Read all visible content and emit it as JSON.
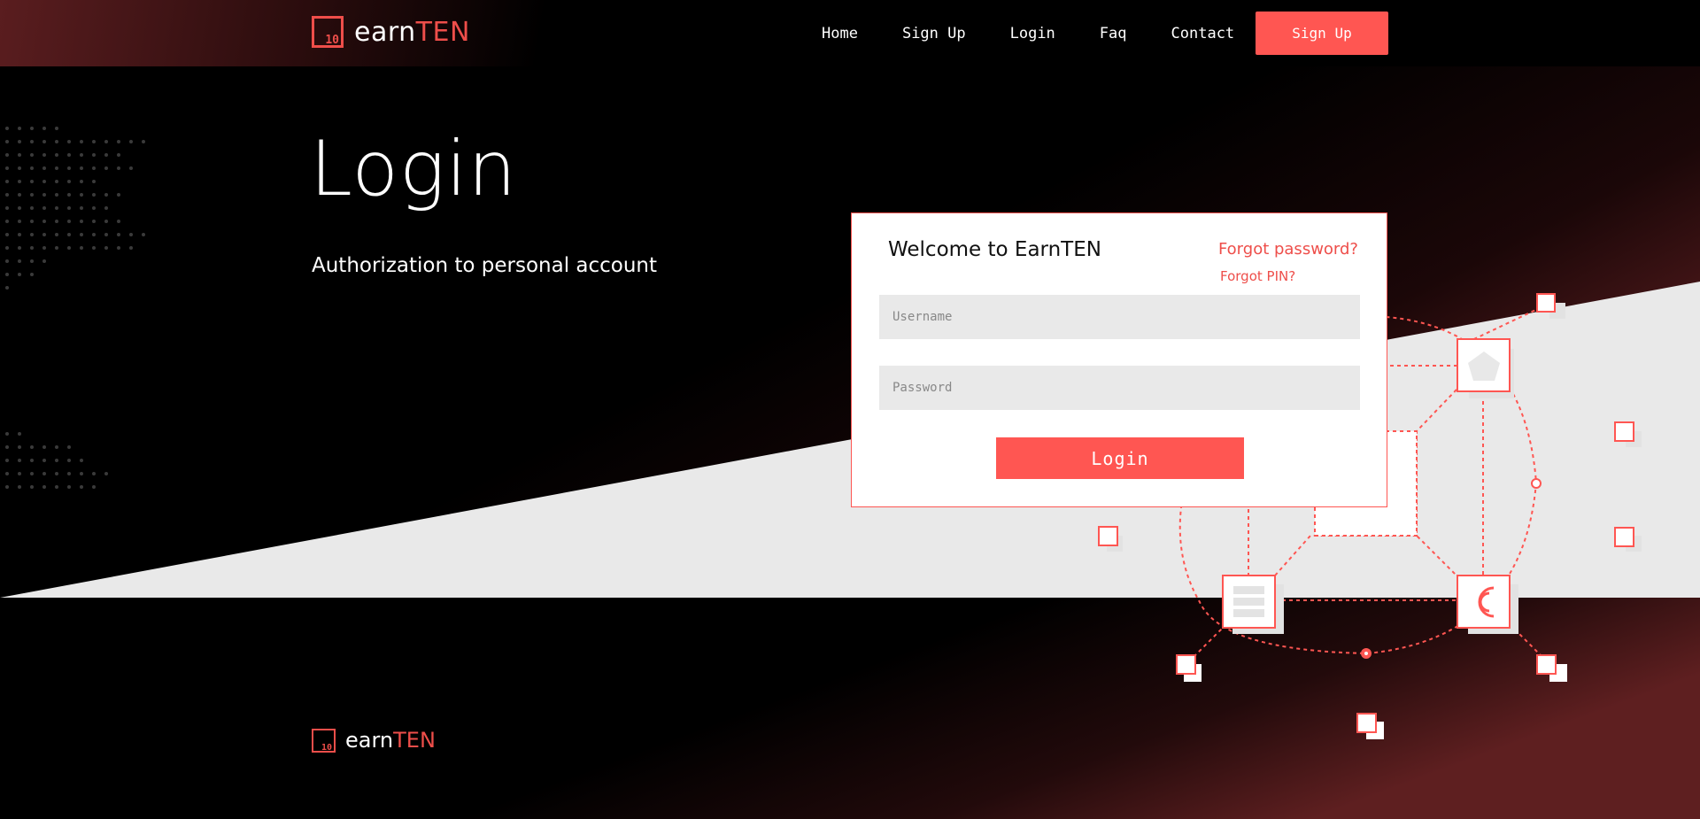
{
  "brand": {
    "logo_mark": "10",
    "name_white": "earn",
    "name_red": "TEN"
  },
  "nav": {
    "items": [
      "Home",
      "Sign Up",
      "Login",
      "Faq",
      "Contact"
    ],
    "cta": "Sign Up"
  },
  "hero": {
    "title": "Login",
    "subtitle": "Authorization to personal account"
  },
  "login_card": {
    "title": "Welcome to EarnTEN",
    "forgot_password": "Forgot password?",
    "forgot_pin": "Forgot PIN?",
    "username_placeholder": "Username",
    "password_placeholder": "Password",
    "submit_label": "Login"
  },
  "colors": {
    "accent": "#ff5652",
    "accent_text": "#ee4e4a",
    "light_band": "#e9e9e9",
    "background": "#000000"
  },
  "icons": [
    "logo-icon",
    "pentagon-icon",
    "list-icon",
    "currency-c-icon"
  ]
}
